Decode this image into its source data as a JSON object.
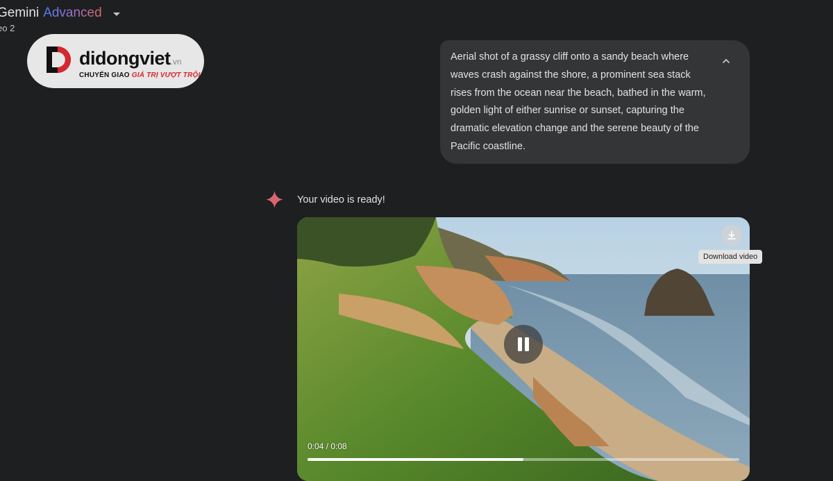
{
  "header": {
    "title_part1": "Gemini",
    "title_part2": "Advanced",
    "subtitle": "eo 2"
  },
  "watermark": {
    "brand": "didongviet",
    "domain_suffix": ".vn",
    "tagline_plain": "CHUYỂN GIAO ",
    "tagline_highlight": "GIÁ TRỊ VƯỢT TRỘI"
  },
  "prompt": {
    "text": "Aerial shot of a grassy cliff onto a sandy beach where waves crash against the shore, a prominent sea stack rises from the ocean near the beach, bathed in the warm, golden light of either sunrise or sunset, capturing the dramatic elevation change and the serene beauty of the Pacific coastline."
  },
  "response": {
    "status_text": "Your video is ready!"
  },
  "video": {
    "time_display": "0:04 / 0:08",
    "progress": 0.5,
    "download_tooltip": "Download video"
  },
  "colors": {
    "background": "#1e1f20",
    "bubble": "#333537",
    "spark": "#d96570",
    "brand_red": "#d7262e"
  },
  "icons": [
    "chevron-down-icon",
    "chevron-up-icon",
    "gemini-spark-icon",
    "download-icon",
    "pause-icon"
  ]
}
